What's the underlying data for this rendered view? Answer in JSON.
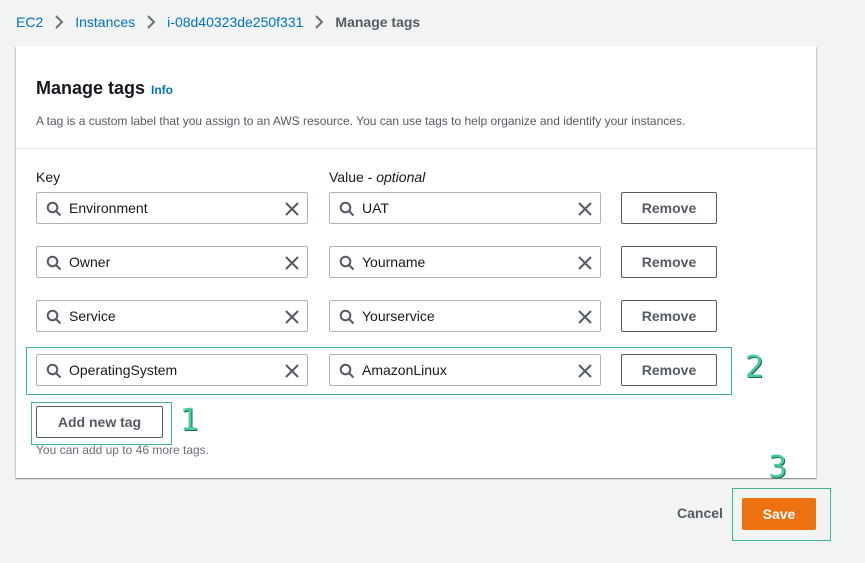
{
  "breadcrumb": {
    "items": [
      "EC2",
      "Instances",
      "i-08d40323de250f331"
    ],
    "current": "Manage tags"
  },
  "panel": {
    "title": "Manage tags",
    "info_label": "Info",
    "description": "A tag is a custom label that you assign to an AWS resource. You can use tags to help organize and identify your instances."
  },
  "columns": {
    "key_label": "Key",
    "value_label_main": "Value - ",
    "value_label_optional": "optional"
  },
  "tags": [
    {
      "key": "Environment",
      "value": "UAT",
      "remove_label": "Remove"
    },
    {
      "key": "Owner",
      "value": "Yourname",
      "remove_label": "Remove"
    },
    {
      "key": "Service",
      "value": "Yourservice",
      "remove_label": "Remove"
    },
    {
      "key": "OperatingSystem",
      "value": "AmazonLinux",
      "remove_label": "Remove"
    }
  ],
  "add_tag_label": "Add new tag",
  "hint": "You can add up to 46 more tags.",
  "footer": {
    "cancel_label": "Cancel",
    "save_label": "Save"
  },
  "annotations": [
    "1",
    "2",
    "3"
  ],
  "colors": {
    "link": "#0073bb",
    "primary_button": "#ec7211",
    "annotation": "#4ecb9c"
  }
}
